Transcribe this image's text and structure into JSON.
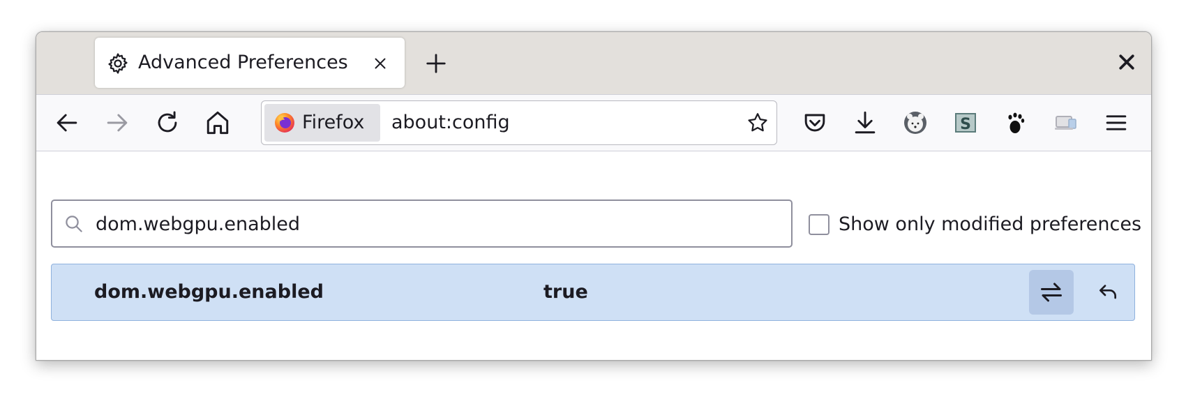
{
  "tab": {
    "title": "Advanced Preferences",
    "icon": "gear-icon"
  },
  "toolbar": {
    "identity_label": "Firefox",
    "url": "about:config"
  },
  "search": {
    "value": "dom.webgpu.enabled",
    "modified_only_label": "Show only modified preferences",
    "modified_only_checked": false
  },
  "preferences": [
    {
      "name": "dom.webgpu.enabled",
      "value": "true"
    }
  ],
  "colors": {
    "tabstrip_bg": "#e3e0dc",
    "navbar_bg": "#f9f9fb",
    "row_bg": "#cfe0f5",
    "toggle_bg": "#b4c8e6",
    "text": "#1c1b22"
  }
}
